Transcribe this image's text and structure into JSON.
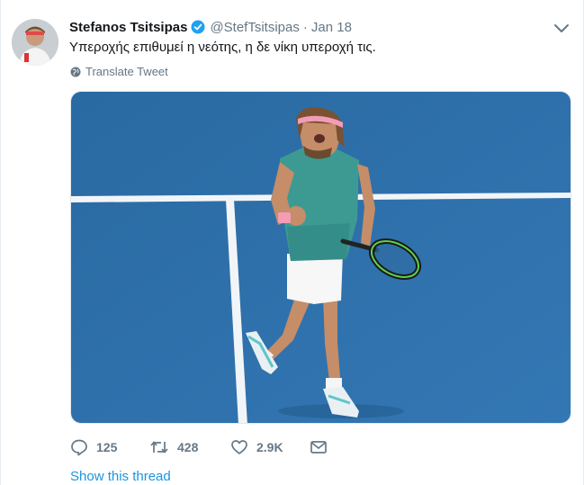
{
  "tweet": {
    "author_name": "Stefanos Tsitsipas",
    "handle": "@StefTsitsipas",
    "separator": "·",
    "time": "Jan 18",
    "text": "Υπεροχής επιθυμεί η νεότης, η δε νίκη υπεροχή τις.",
    "translate_label": "Translate Tweet",
    "icons": {
      "verified": "verified-badge-icon",
      "more": "chevron-down-icon",
      "globe": "globe-icon"
    }
  },
  "actions": {
    "replies": "125",
    "retweets": "428",
    "likes": "2.9K",
    "icons": [
      "reply-icon",
      "retweet-icon",
      "like-icon",
      "direct-message-icon"
    ]
  },
  "show_thread_label": "Show this thread",
  "colors": {
    "verified_blue": "#1da1f2",
    "link_blue": "#1b95e0",
    "muted_gray": "#657786",
    "court_blue": "#2c6fa8"
  }
}
